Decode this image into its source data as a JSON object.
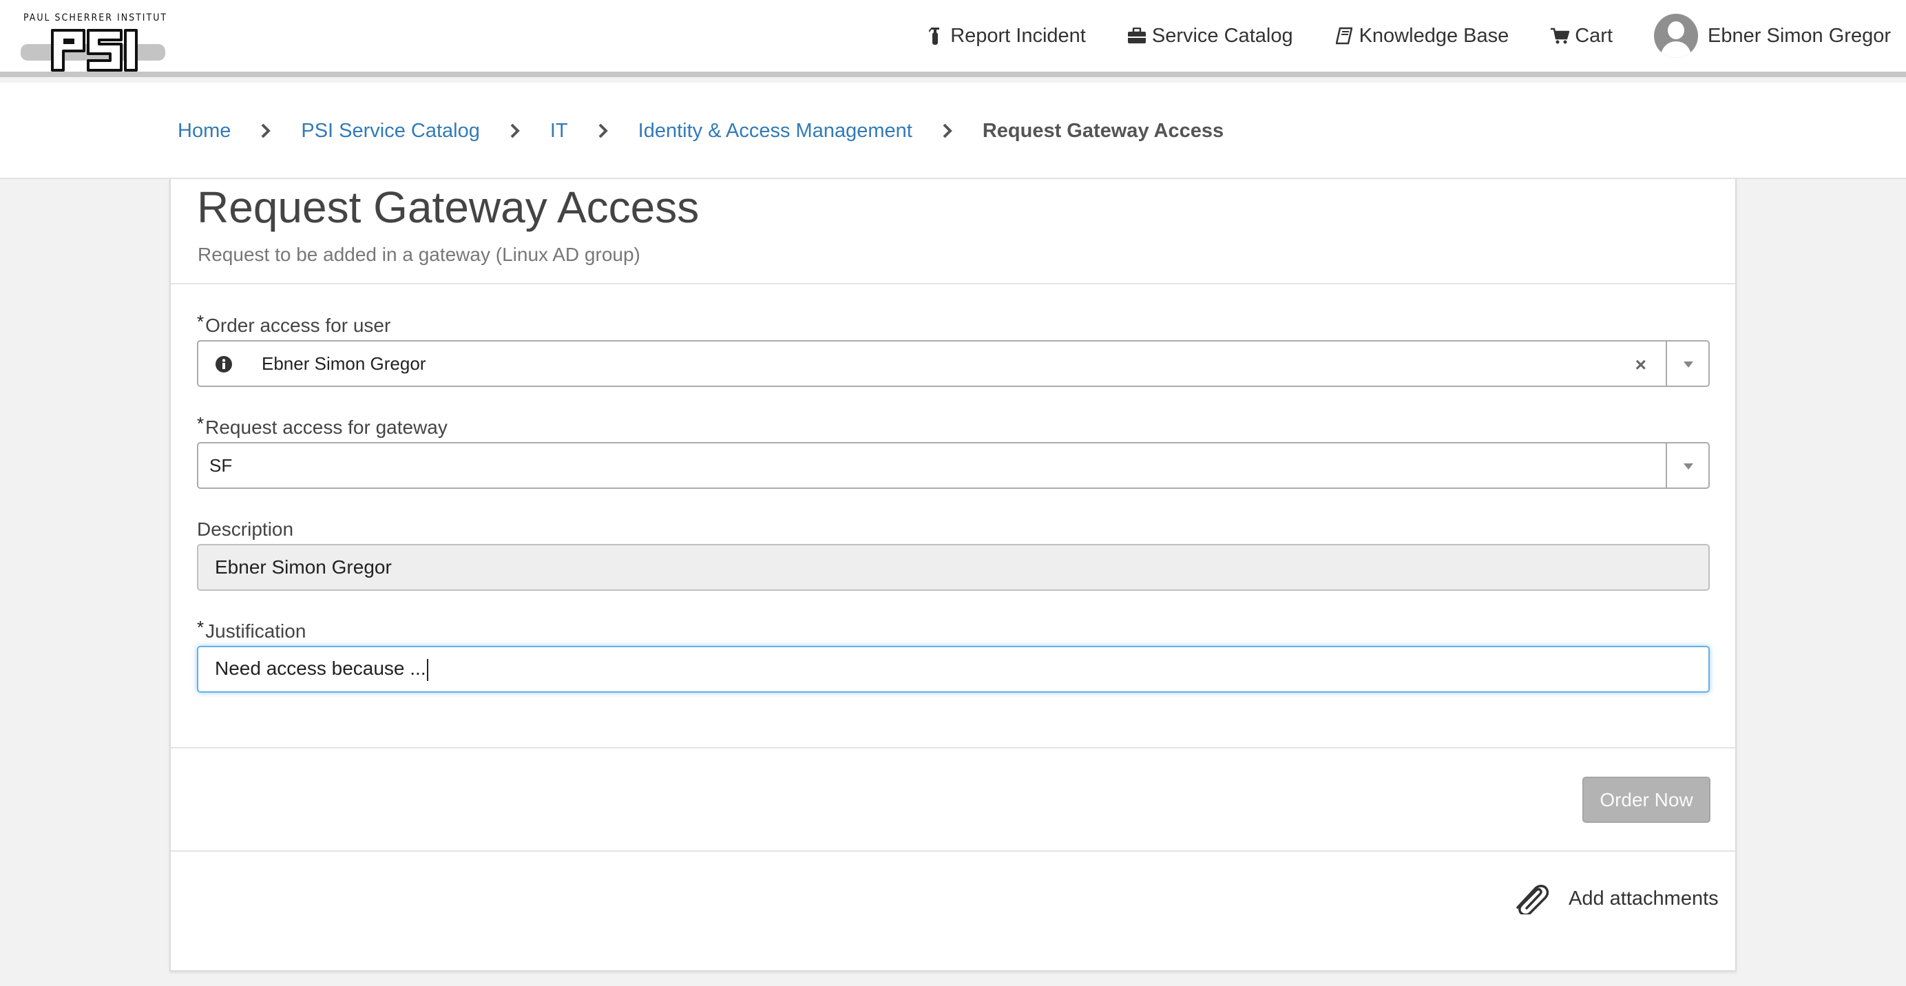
{
  "header": {
    "logo_text": "PAUL SCHERRER INSTITUT",
    "nav": {
      "report_incident": "Report Incident",
      "service_catalog": "Service Catalog",
      "knowledge_base": "Knowledge Base",
      "cart": "Cart",
      "user_name": "Ebner Simon Gregor"
    }
  },
  "breadcrumb": {
    "items": [
      "Home",
      "PSI Service Catalog",
      "IT",
      "Identity & Access Management"
    ],
    "current": "Request Gateway Access"
  },
  "form": {
    "title": "Request Gateway Access",
    "subtitle": "Request to be added in a gateway (Linux AD group)",
    "required_mark": "*",
    "fields": {
      "order_user": {
        "label": "Order access for user",
        "value": "Ebner Simon Gregor",
        "clear": "×"
      },
      "gateway": {
        "label": "Request access for gateway",
        "value": "SF"
      },
      "description": {
        "label": "Description",
        "value": "Ebner Simon Gregor"
      },
      "justification": {
        "label": "Justification",
        "value": "Need access because ..."
      }
    },
    "order_button": "Order Now",
    "attachments_label": "Add attachments"
  },
  "colors": {
    "link": "#337ab7",
    "order_button_bg": "#b3b3b3",
    "focus_border": "#66afe9"
  }
}
